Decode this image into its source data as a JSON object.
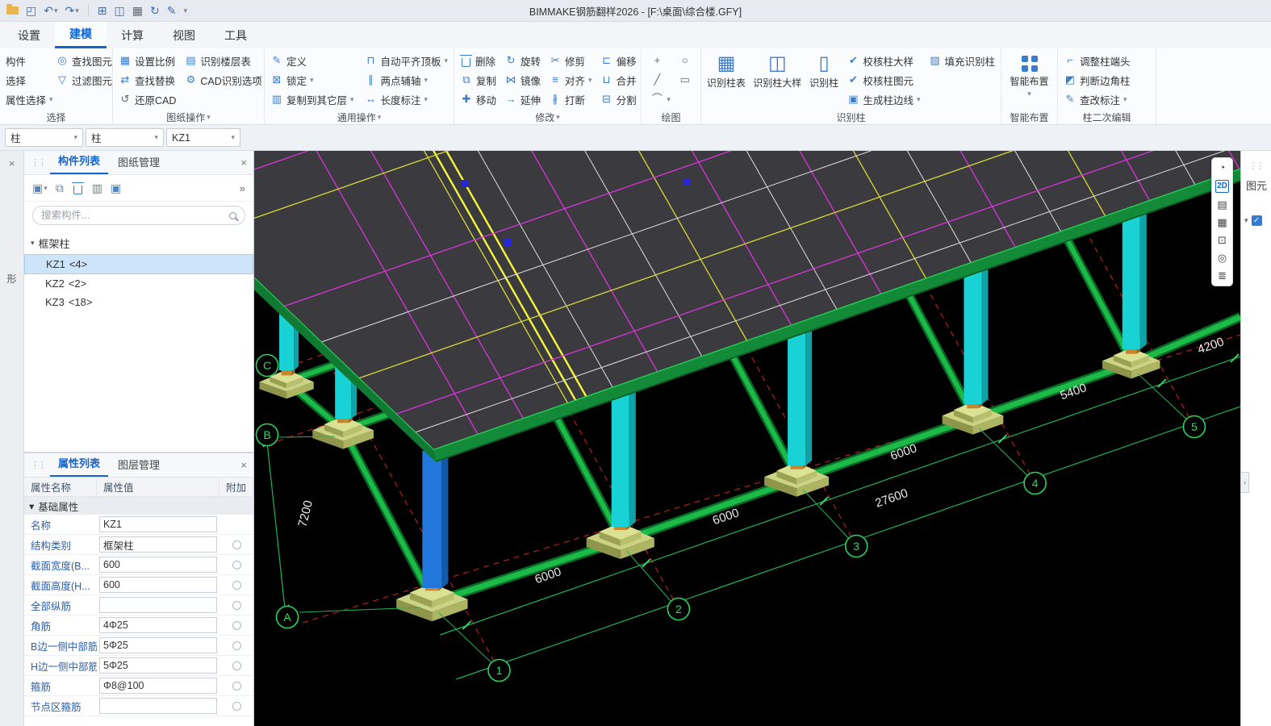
{
  "window": {
    "title": "BIMMAKE钢筋翻样2026 - [F:\\桌面\\综合楼.GFY]"
  },
  "glyphs": {
    "caret": "▾",
    "close": "×",
    "more": "»",
    "grip": "⋮⋮",
    "check": "✓",
    "save": "◰",
    "undo": "↶",
    "redo": "↷",
    "calc": "⊞",
    "win": "◫",
    "table": "▦",
    "sync": "↻",
    "pen": "✎",
    "find": "◎",
    "filter": "▽",
    "scale": "▦",
    "floors": "▤",
    "replace": "⇄",
    "cad_opt": "⚙",
    "restore_cad": "↺",
    "define": "✎",
    "lock": "⊠",
    "copy_layer": "▥",
    "align_top": "⊓",
    "two_axis": "∥",
    "length": "↔",
    "copy": "⧉",
    "move": "✚",
    "rotate": "↻",
    "mirror": "⋈",
    "extend": "→",
    "trim": "✂",
    "align": "≡",
    "break": "∦",
    "offset": "⊏",
    "merge": "⊔",
    "split": "⊟",
    "point": "+",
    "circle": "○",
    "line": "╱",
    "rect": "▭",
    "arc": "⌒",
    "col_table": "▦",
    "col_sample": "◫",
    "col_rec": "▯",
    "check_sample": "✔",
    "check_item": "✔",
    "col_edge": "▣",
    "col_fill": "▨",
    "adjust": "⌐",
    "corner": "◩",
    "mark": "✎",
    "tree_caret": "▾",
    "new_item": "▣"
  },
  "ribbon": {
    "tabs": [
      {
        "label": "设置"
      },
      {
        "label": "建模"
      },
      {
        "label": "计算"
      },
      {
        "label": "视图"
      },
      {
        "label": "工具"
      }
    ],
    "select_group": {
      "label": "选择",
      "col1": [
        "构件",
        "选择",
        "属性选择"
      ],
      "col2": [
        "查找图元",
        "过滤图元"
      ]
    },
    "sheet_group": {
      "label": "图纸操作",
      "r1a": "设置比例",
      "r1b": "识别楼层表",
      "r2a": "查找替换",
      "r2b": "CAD识别选项",
      "r3a": "还原CAD"
    },
    "common_group": {
      "label": "通用操作",
      "col1": [
        "定义",
        "锁定",
        "复制到其它层"
      ],
      "col2": [
        "自动平齐顶板",
        "两点辅轴",
        "长度标注"
      ]
    },
    "modify_group": {
      "label": "修改",
      "col1": [
        "删除",
        "复制",
        "移动"
      ],
      "col2": [
        "旋转",
        "镜像",
        "延伸"
      ],
      "col3": [
        "修剪",
        "对齐",
        "打断"
      ],
      "col4": [
        "偏移",
        "合并",
        "分割"
      ]
    },
    "draw_group": {
      "label": "绘图"
    },
    "column_group": {
      "label": "识别柱",
      "big": [
        "识别柱表",
        "识别柱大样",
        "识别柱"
      ],
      "small": [
        "校核柱大样",
        "校核柱图元",
        "生成柱边线"
      ],
      "extra": "填充识别柱"
    },
    "smart_group": {
      "label": "智能布置",
      "button": "智能布置"
    },
    "edit_group": {
      "label": "柱二次编辑",
      "items": [
        "调整柱端头",
        "判断边角柱",
        "查改标注"
      ]
    }
  },
  "selector_bar": {
    "fields": [
      {
        "value": "柱"
      },
      {
        "value": "柱"
      },
      {
        "value": "KZ1"
      }
    ]
  },
  "left_strip": {
    "tab": "形"
  },
  "component_panel": {
    "tabs": [
      {
        "label": "构件列表"
      },
      {
        "label": "图纸管理"
      }
    ],
    "search_placeholder": "搜索构件...",
    "tree": {
      "group": "框架柱",
      "items": [
        {
          "name": "KZ1",
          "count": "<4>"
        },
        {
          "name": "KZ2",
          "count": "<2>"
        },
        {
          "name": "KZ3",
          "count": "<18>"
        }
      ]
    }
  },
  "property_panel": {
    "tabs": [
      {
        "label": "属性列表"
      },
      {
        "label": "图层管理"
      }
    ],
    "columns": [
      "属性名称",
      "属性值",
      "附加"
    ],
    "section": "基础属性",
    "rows": [
      {
        "label": "名称",
        "value": "KZ1"
      },
      {
        "label": "结构类别",
        "value": "框架柱"
      },
      {
        "label": "截面宽度(B...",
        "value": "600"
      },
      {
        "label": "截面高度(H...",
        "value": "600"
      },
      {
        "label": "全部纵筋",
        "value": ""
      },
      {
        "label": "角筋",
        "value": "4Φ25"
      },
      {
        "label": "B边一侧中部筋",
        "value": "5Φ25"
      },
      {
        "label": "H边一侧中部筋",
        "value": "5Φ25"
      },
      {
        "label": "箍筋",
        "value": "Φ8@100"
      },
      {
        "label": "节点区箍筋",
        "value": ""
      }
    ]
  },
  "viewport": {
    "dims": {
      "span1": "6000",
      "span2": "6000",
      "span3": "6000",
      "span4": "5400",
      "span5": "4200",
      "total": "27600",
      "left": "7200"
    },
    "letters": [
      "A",
      "B",
      "C"
    ],
    "numbers": [
      "1",
      "2",
      "3",
      "4",
      "5"
    ],
    "colors": {
      "beam": "#1cba47",
      "column": "#18d2d6",
      "selected_column": "#2277dd",
      "slab": "#3b3b3f",
      "grid_magenta": "#d834d8",
      "grid_yellow": "#d8d838",
      "axis_red": "#c22222",
      "dim_green": "#28d45c",
      "footing": "#cdd384"
    }
  },
  "right_toolbar": {
    "items": [
      {
        "glyph": "◔"
      },
      {
        "glyph": "2D"
      },
      {
        "glyph": "▤"
      },
      {
        "glyph": "▦"
      },
      {
        "glyph": "⊡"
      },
      {
        "glyph": "◎"
      },
      {
        "glyph": "≣"
      }
    ]
  },
  "right_panel": {
    "title": "图元"
  }
}
